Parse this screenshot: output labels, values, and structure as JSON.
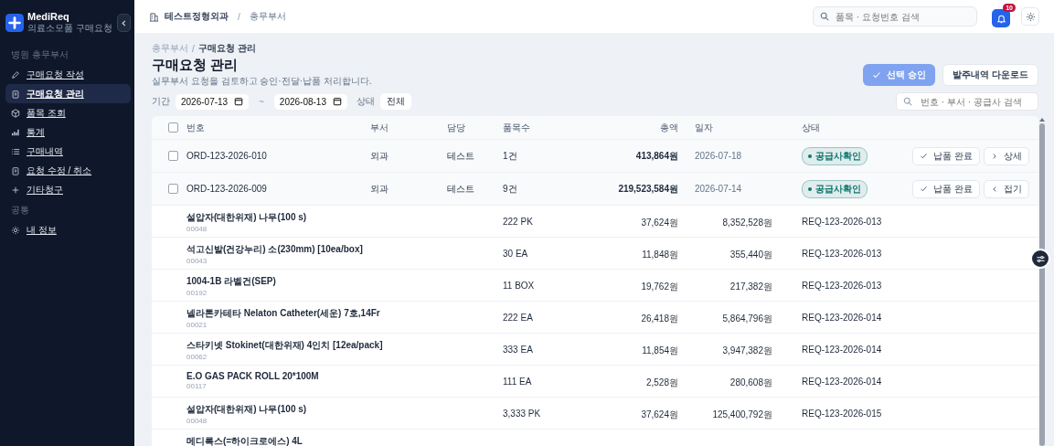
{
  "sidebar": {
    "logo": {
      "title": "MediReq",
      "subtitle": "의료소모품 구매요청"
    },
    "sections": [
      {
        "title": "병원 총무부서",
        "items": [
          {
            "label": "구매요청 작성",
            "selected": false
          },
          {
            "label": "구매요청 관리",
            "selected": true
          },
          {
            "label": "품목 조회",
            "selected": false
          },
          {
            "label": "통계",
            "selected": false
          },
          {
            "label": "구매내역",
            "selected": false
          },
          {
            "label": "요청 수정 / 취소",
            "selected": false
          },
          {
            "label": "기타청구",
            "selected": false
          }
        ]
      },
      {
        "title": "공통",
        "items": [
          {
            "label": "내 정보",
            "selected": false
          }
        ]
      }
    ]
  },
  "topbar": {
    "breadcrumb": [
      "테스트정형외과",
      "총무부서"
    ],
    "separator": "/",
    "search": {
      "placeholder": "품목 · 요청번호 검색"
    },
    "notifications": "10"
  },
  "page": {
    "breadcrumb": [
      "총무부서",
      "구매요청 관리"
    ],
    "separator": "/",
    "title": "구매요청 관리",
    "subtitle": "실무부서 요청을 검토하고 승인·전달·납품 처리합니다.",
    "actions": [
      {
        "label": "선택 승인",
        "kind": "primary",
        "disabled": true
      },
      {
        "label": "발주내역 다운로드",
        "kind": "secondary",
        "disabled": false
      }
    ],
    "filters": {
      "period_label": "기간",
      "from": "2026-07-13",
      "separator": "~",
      "to": "2026-08-13",
      "status_label": "상태",
      "status": "전체",
      "search": {
        "placeholder": "번호 · 부서 · 공급사 검색"
      }
    }
  },
  "table": {
    "all_checked": false,
    "columns": [
      "번호",
      "부서",
      "담당",
      "품목수",
      "총액",
      "일자",
      "상태"
    ],
    "rows": [
      {
        "kind": "order",
        "checked": false,
        "number": "ORD-123-2026-010",
        "dept": "외과",
        "owner": "테스트",
        "count": "1건",
        "total": "413,864원",
        "date": "2026-07-18",
        "status": "공급사확인",
        "color": "#0f766e",
        "actions": [
          "납품 완료",
          "상세"
        ],
        "expanded": false
      },
      {
        "kind": "order",
        "checked": false,
        "number": "ORD-123-2026-009",
        "dept": "외과",
        "owner": "테스트",
        "count": "9건",
        "total": "219,523,584원",
        "date": "2026-07-14",
        "status": "공급사확인",
        "color": "#0f766e",
        "actions": [
          "납품 완료",
          "접기"
        ],
        "expanded": true
      },
      {
        "kind": "item",
        "name": "설압자(대한위재) 나무(100 s)",
        "code": "00048",
        "qty": "222 PK",
        "price": "37,624원",
        "amount": "8,352,528원",
        "req": "REQ-123-2026-013"
      },
      {
        "kind": "item",
        "name": "석고신발(건강누리) 소(230mm) [10ea/box]",
        "code": "00043",
        "qty": "30 EA",
        "price": "11,848원",
        "amount": "355,440원",
        "req": "REQ-123-2026-013"
      },
      {
        "kind": "item",
        "name": "1004-1B 라벨건(SEP)",
        "code": "00192",
        "qty": "11 BOX",
        "price": "19,762원",
        "amount": "217,382원",
        "req": "REQ-123-2026-013"
      },
      {
        "kind": "item",
        "name": "넬라톤카테타 Nelaton Catheter(세운) 7호,14Fr",
        "code": "00021",
        "qty": "222 EA",
        "price": "26,418원",
        "amount": "5,864,796원",
        "req": "REQ-123-2026-014"
      },
      {
        "kind": "item",
        "name": "스타키넷 Stokinet(대한위재) 4인치 [12ea/pack]",
        "code": "00062",
        "qty": "333 EA",
        "price": "11,854원",
        "amount": "3,947,382원",
        "req": "REQ-123-2026-014"
      },
      {
        "kind": "item",
        "name": "E.O GAS PACK ROLL 20*100M",
        "code": "00117",
        "qty": "111 EA",
        "price": "2,528원",
        "amount": "280,608원",
        "req": "REQ-123-2026-014"
      },
      {
        "kind": "item",
        "name": "설압자(대한위재) 나무(100 s)",
        "code": "00048",
        "qty": "3,333 PK",
        "price": "37,624원",
        "amount": "125,400,792원",
        "req": "REQ-123-2026-015"
      },
      {
        "kind": "item",
        "name": "메디록스(=하이크로에스) 4L"
      }
    ]
  }
}
